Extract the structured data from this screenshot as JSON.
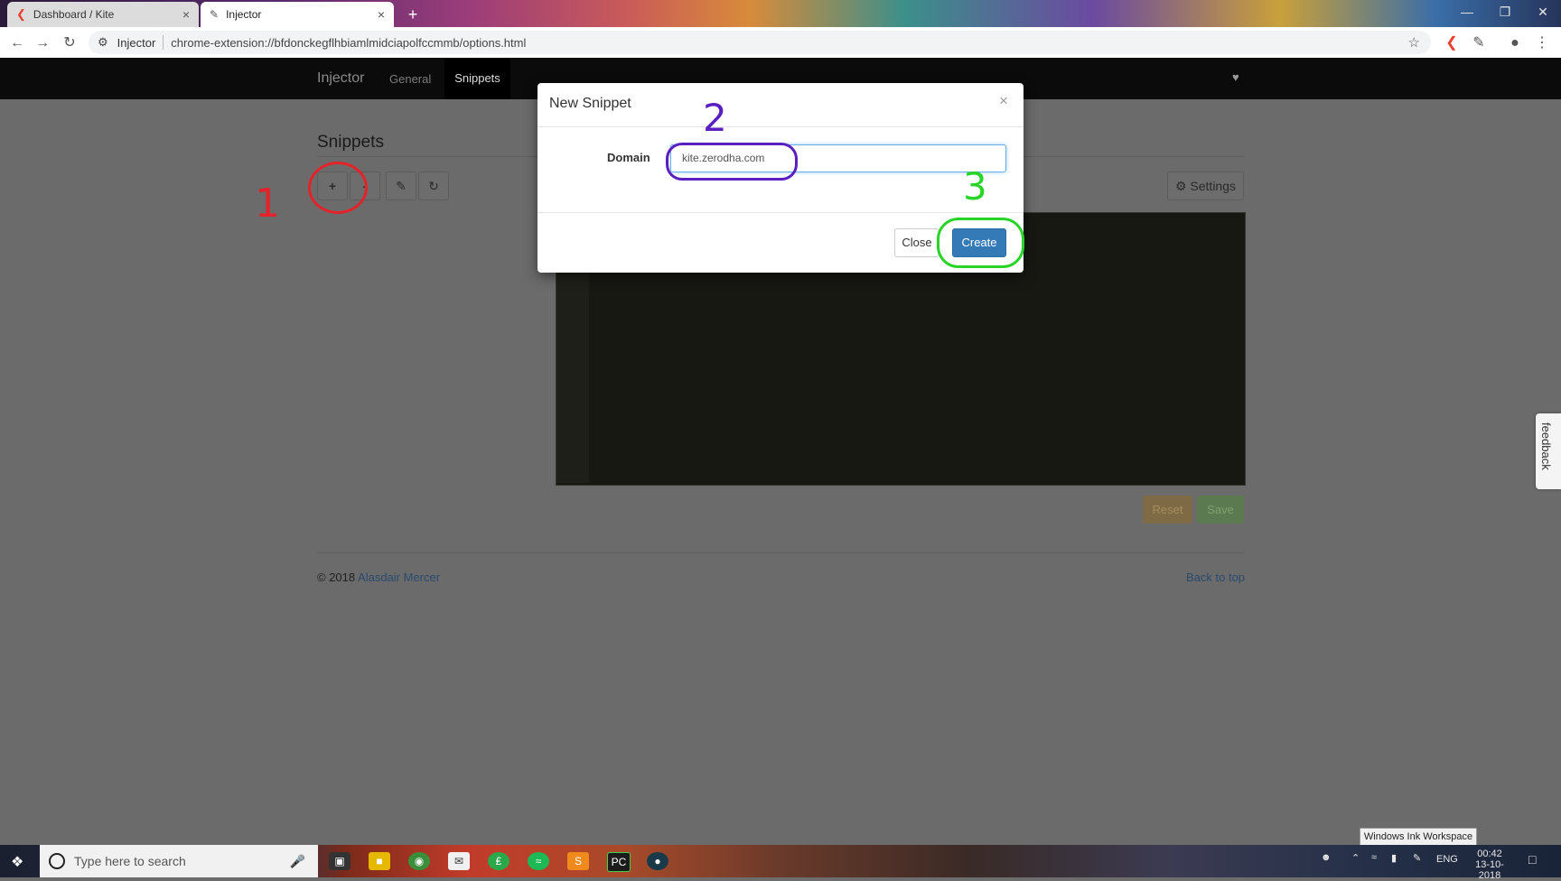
{
  "browser": {
    "tabs": [
      {
        "title": "Dashboard / Kite",
        "active": false
      },
      {
        "title": "Injector",
        "active": true
      }
    ],
    "address": {
      "site_label": "Injector",
      "url": "chrome-extension://bfdonckegflhbiamlmidciapolfccmmb/options.html"
    }
  },
  "app": {
    "brand": "Injector",
    "nav": [
      {
        "label": "General",
        "active": false
      },
      {
        "label": "Snippets",
        "active": true
      }
    ],
    "heading": "Snippets",
    "toolbar": {
      "add_label": "+",
      "remove_label": "-",
      "edit_icon": "pencil-icon",
      "refresh_icon": "refresh-icon",
      "settings_label": "Settings"
    },
    "actions": {
      "reset_label": "Reset",
      "save_label": "Save"
    },
    "footer": {
      "copyright": "© 2018",
      "author": "Alasdair Mercer",
      "back_to_top": "Back to top"
    },
    "feedback_label": "feedback"
  },
  "modal": {
    "title": "New Snippet",
    "close_symbol": "×",
    "field_label": "Domain",
    "field_value": "kite.zerodha.com",
    "close_label": "Close",
    "create_label": "Create"
  },
  "annotations": {
    "step1": "1",
    "step2": "2",
    "step3": "3",
    "step1_color": "#e3232a",
    "step2_color": "#5a1fc0",
    "step3_color": "#29d428"
  },
  "taskbar": {
    "search_placeholder": "Type here to search",
    "tooltip": "Windows Ink Workspace",
    "language": "ENG",
    "time": "00:42",
    "date": "13-10-2018"
  }
}
